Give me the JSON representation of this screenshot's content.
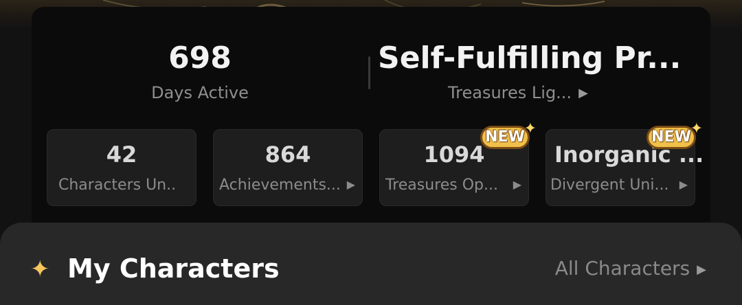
{
  "hero": {
    "days_value": "698",
    "days_label": "Days Active",
    "treasure_value": "Self-Fulfilling Pr...",
    "treasure_label": "Treasures Lig..."
  },
  "tiles": [
    {
      "value": "42",
      "label": "Characters Un...",
      "has_arrow": false,
      "badge": ""
    },
    {
      "value": "864",
      "label": "Achievements...",
      "has_arrow": true,
      "badge": ""
    },
    {
      "value": "1094",
      "label": "Treasures Op...",
      "has_arrow": true,
      "badge": "NEW"
    },
    {
      "value": "Inorganic ...",
      "label": "Divergent Uni...",
      "has_arrow": true,
      "badge": "NEW"
    }
  ],
  "section": {
    "title": "My Characters",
    "link": "All Characters"
  },
  "icons": {
    "arrow": "chevron-right-icon",
    "star": "sparkle-icon"
  },
  "colors": {
    "badge_fill": "#f0c04a",
    "badge_outline": "#7a4b14",
    "star": "#f6c55c"
  }
}
